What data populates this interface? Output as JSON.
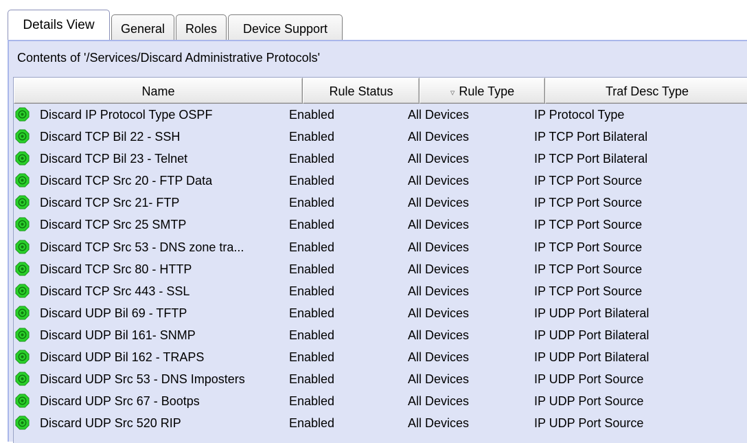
{
  "tabs": [
    {
      "label": "Details View",
      "active": true
    },
    {
      "label": "General",
      "active": false
    },
    {
      "label": "Roles",
      "active": false
    },
    {
      "label": "Device Support",
      "active": false
    }
  ],
  "panel": {
    "title": "Contents of '/Services/Discard Administrative Protocols'"
  },
  "table": {
    "columns": [
      {
        "label": "Name"
      },
      {
        "label": "Rule Status"
      },
      {
        "label": "Rule Type",
        "sort_icon": "filter-icon"
      },
      {
        "label": "Traf Desc Type"
      }
    ],
    "row_icon": "green-status-icon",
    "rows": [
      {
        "name": "Discard IP Protocol Type OSPF",
        "status": "Enabled",
        "rule_type": "All Devices",
        "traf_desc_type": "IP Protocol Type"
      },
      {
        "name": "Discard TCP Bil 22 - SSH",
        "status": "Enabled",
        "rule_type": "All Devices",
        "traf_desc_type": "IP TCP Port Bilateral"
      },
      {
        "name": "Discard TCP Bil 23 - Telnet",
        "status": "Enabled",
        "rule_type": "All Devices",
        "traf_desc_type": "IP TCP Port Bilateral"
      },
      {
        "name": "Discard TCP Src 20 - FTP Data",
        "status": "Enabled",
        "rule_type": "All Devices",
        "traf_desc_type": "IP TCP Port Source"
      },
      {
        "name": "Discard TCP Src 21- FTP",
        "status": "Enabled",
        "rule_type": "All Devices",
        "traf_desc_type": "IP TCP Port Source"
      },
      {
        "name": "Discard TCP Src 25 SMTP",
        "status": "Enabled",
        "rule_type": "All Devices",
        "traf_desc_type": "IP TCP Port Source"
      },
      {
        "name": "Discard TCP Src 53 - DNS zone tra...",
        "status": "Enabled",
        "rule_type": "All Devices",
        "traf_desc_type": "IP TCP Port Source"
      },
      {
        "name": "Discard TCP Src 80 - HTTP",
        "status": "Enabled",
        "rule_type": "All Devices",
        "traf_desc_type": "IP TCP Port Source"
      },
      {
        "name": "Discard TCP Src 443 - SSL",
        "status": "Enabled",
        "rule_type": "All Devices",
        "traf_desc_type": "IP TCP Port Source"
      },
      {
        "name": "Discard UDP Bil 69 - TFTP",
        "status": "Enabled",
        "rule_type": "All Devices",
        "traf_desc_type": "IP UDP Port Bilateral"
      },
      {
        "name": "Discard UDP Bil 161- SNMP",
        "status": "Enabled",
        "rule_type": "All Devices",
        "traf_desc_type": "IP UDP Port Bilateral"
      },
      {
        "name": "Discard UDP Bil 162 - TRAPS",
        "status": "Enabled",
        "rule_type": "All Devices",
        "traf_desc_type": "IP UDP Port Bilateral"
      },
      {
        "name": "Discard UDP Src 53 - DNS Imposters",
        "status": "Enabled",
        "rule_type": "All Devices",
        "traf_desc_type": "IP UDP Port Source"
      },
      {
        "name": "Discard UDP Src 67 - Bootps",
        "status": "Enabled",
        "rule_type": "All Devices",
        "traf_desc_type": "IP UDP Port Source"
      },
      {
        "name": "Discard UDP Src 520 RIP",
        "status": "Enabled",
        "rule_type": "All Devices",
        "traf_desc_type": "IP UDP Port Source"
      }
    ]
  },
  "colors": {
    "panel_bg": "#dfe3f6",
    "panel_border": "#a9b6ea",
    "status_green": "#2bd12b"
  }
}
